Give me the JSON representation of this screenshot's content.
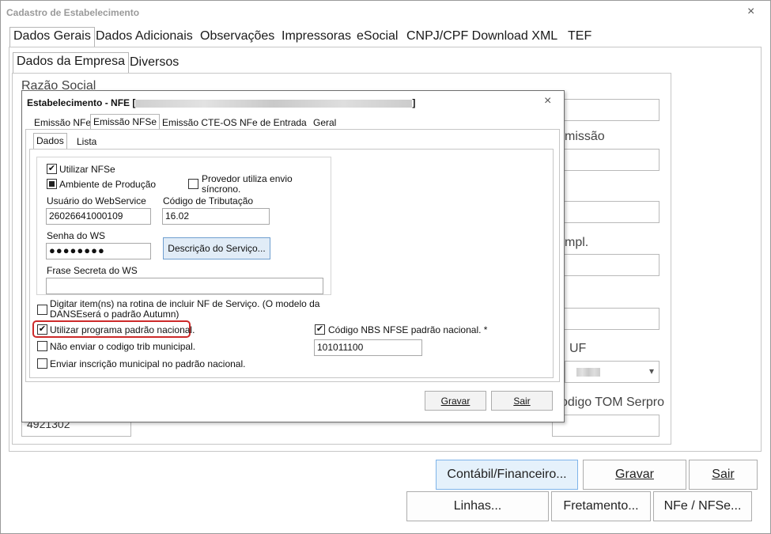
{
  "window": {
    "title": "Cadastro de Estabelecimento",
    "close": "×"
  },
  "main_tabs": [
    "Dados Gerais",
    "Dados Adicionais",
    "Observações",
    "Impressoras",
    "eSocial",
    "CNPJ/CPF Download XML",
    "TEF"
  ],
  "sub_tabs": [
    "Dados da Empresa",
    "Diversos"
  ],
  "bg_labels": {
    "razao_social": "Razão Social",
    "emissao": "missão",
    "compl": "mpl.",
    "uf": "UF",
    "codigo_tom": "odigo TOM Serpro"
  },
  "bg_values": {
    "cnae": "4921302",
    "uf_value": ""
  },
  "dialog": {
    "title_prefix": "Estabelecimento - NFE [",
    "title_suffix": "]",
    "close": "×",
    "tabs": [
      "Emissão NFe",
      "Emissão NFSe",
      "Emissão CTE-OS",
      "NFe de Entrada",
      "Geral"
    ],
    "inner_tabs": [
      "Dados",
      "Lista"
    ],
    "utilizar_nfse": "Utilizar NFSe",
    "ambiente_producao": "Ambiente de Produção",
    "provedor_line1": "Provedor utiliza envio",
    "provedor_line2": "síncrono.",
    "usuario_label": "Usuário do WebService",
    "usuario_value": "26026641000109",
    "codigo_trib_label": "Código de Tributação",
    "codigo_trib_value": "16.02",
    "senha_label": "Senha do WS",
    "senha_value": "●●●●●●●●",
    "descricao_btn": "Descrição do Serviço...",
    "frase_label": "Frase Secreta do WS",
    "frase_value": "",
    "digitar_line1": "Digitar item(ns) na rotina de incluir NF de Serviço. (O modelo da",
    "digitar_line2": "DANSEserá o padrão Autumn)",
    "utilizar_programa": "Utilizar programa padrão nacional.",
    "nao_enviar": "Não enviar o codigo trib municipal.",
    "enviar_inscricao": "Enviar inscrição municipal no padrão nacional.",
    "codigo_nbs_label": "Código NBS NFSE padrão nacional. *",
    "codigo_nbs_value": "101011100",
    "check_mark": "✔",
    "gravar": "Gravar",
    "sair": "Sair"
  },
  "bottom_buttons": {
    "contabil": "Contábil/Financeiro...",
    "gravar": "Gravar",
    "sair": "Sair",
    "linhas": "Linhas...",
    "fretamento": "Fretamento...",
    "nfe_nfse": "NFe / NFSe..."
  },
  "icons": {
    "dropdown": "▾"
  }
}
